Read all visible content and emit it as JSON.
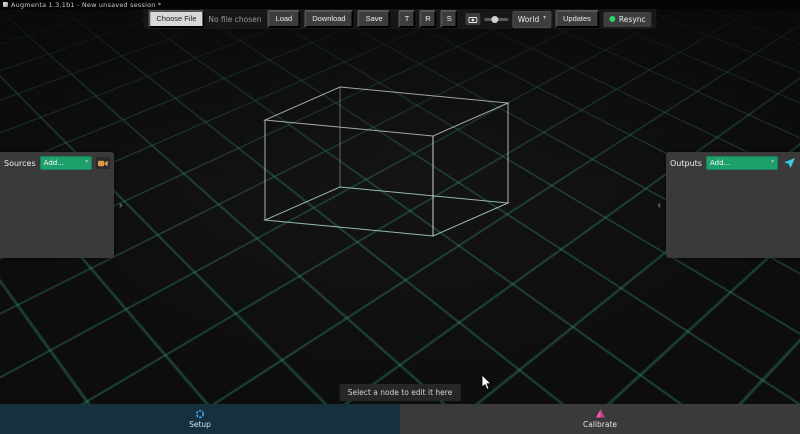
{
  "titlebar": {
    "title": "Augmenta 1.3.1b1 - New unsaved session *"
  },
  "toolbar": {
    "choose_file": "Choose File",
    "file_status": "No file chosen",
    "load": "Load",
    "download": "Download",
    "save": "Save",
    "transform_buttons": [
      "T",
      "R",
      "S"
    ],
    "snapshot_icon": "camera-icon",
    "space_select": {
      "value": "World"
    },
    "updates": "Updates",
    "resync": "Resync",
    "resync_status": "online-green-dot"
  },
  "panels": {
    "sources": {
      "title": "Sources",
      "add_select": "Add...",
      "icon": "video-camera-icon",
      "collapse": "›"
    },
    "outputs": {
      "title": "Outputs",
      "add_select": "Add...",
      "icon": "send-icon",
      "collapse": "‹"
    }
  },
  "viewport": {
    "tooltip": "Select a node to edit it here"
  },
  "tabs": {
    "setup": "Setup",
    "calibrate": "Calibrate"
  },
  "icons": {
    "caret_down": "▾"
  },
  "colors": {
    "accent_green": "#1da06b",
    "resync_green": "#2fd06b",
    "grid_teal": "#3eaa8a",
    "setup_blue": "#3f9ff0",
    "calibrate_pink": "#ef5da8",
    "camera_orange": "#d99a4e",
    "send_cyan": "#3fc9e0"
  }
}
